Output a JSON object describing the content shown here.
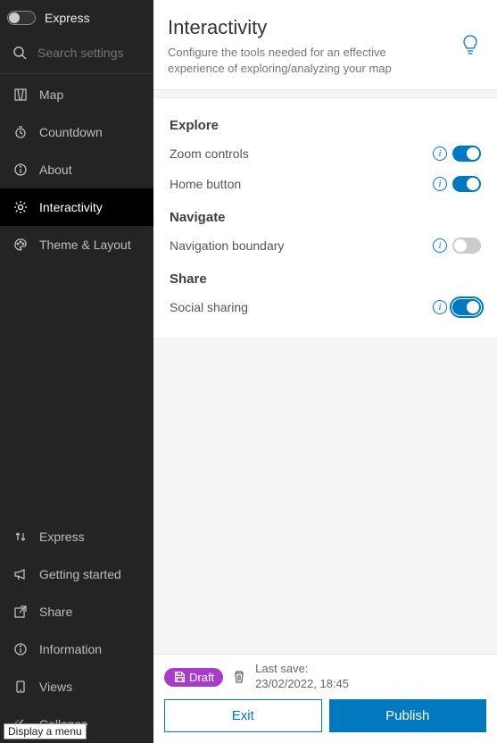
{
  "sidebar": {
    "express_label": "Express",
    "search_placeholder": "Search settings",
    "items": [
      {
        "label": "Map"
      },
      {
        "label": "Countdown"
      },
      {
        "label": "About"
      },
      {
        "label": "Interactivity"
      },
      {
        "label": "Theme & Layout"
      }
    ],
    "bottom_items": [
      {
        "label": "Express"
      },
      {
        "label": "Getting started"
      },
      {
        "label": "Share"
      },
      {
        "label": "Information"
      },
      {
        "label": "Views"
      },
      {
        "label": "Collapse"
      }
    ]
  },
  "header": {
    "title": "Interactivity",
    "subtitle": "Configure the tools needed for an effective experience of exploring/analyzing your map"
  },
  "sections": {
    "explore": {
      "title": "Explore",
      "zoom_controls": "Zoom controls",
      "home_button": "Home button"
    },
    "navigate": {
      "title": "Navigate",
      "navigation_boundary": "Navigation boundary"
    },
    "share": {
      "title": "Share",
      "social_sharing": "Social sharing"
    }
  },
  "footer": {
    "draft_label": "Draft",
    "last_save_label": "Last save:",
    "last_save_value": "23/02/2022, 18:45",
    "exit": "Exit",
    "publish": "Publish"
  },
  "tooltip": "Display a menu"
}
